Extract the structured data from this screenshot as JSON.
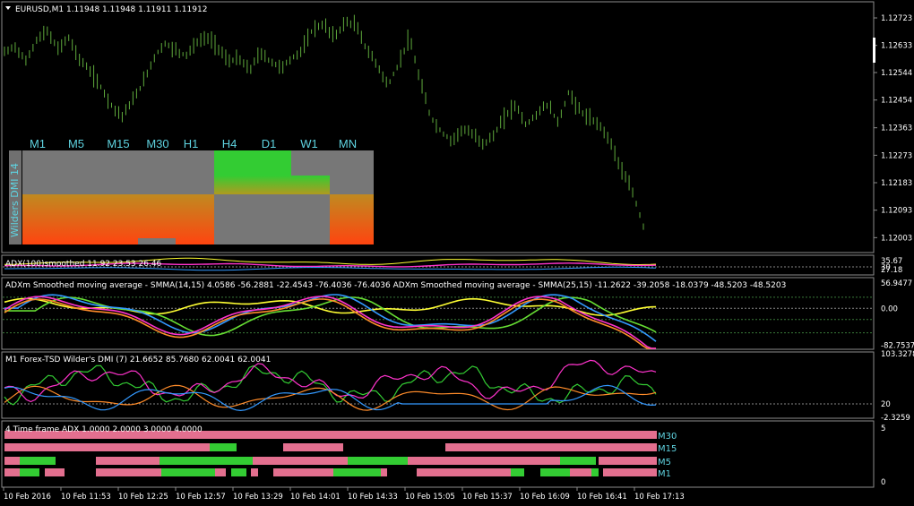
{
  "header": {
    "symbol_label": "EURUSD,M1  1.11948 1.11948 1.11911 1.11912"
  },
  "main_axis": {
    "ticks": [
      "1.12723",
      "1.12633",
      "1.12544",
      "1.12454",
      "1.12363",
      "1.12273",
      "1.12183",
      "1.12093",
      "1.12003"
    ],
    "ylim": [
      1.1196,
      1.1277
    ]
  },
  "dmi_panel": {
    "side_label": "Wilders DMI 14",
    "timeframes": [
      "M1",
      "M5",
      "M15",
      "M30",
      "H1",
      "H4",
      "D1",
      "W1",
      "MN"
    ]
  },
  "pane_adx100": {
    "label": "ADX(100)smoothed 11.92 23.53 26.46",
    "ticks": [
      "35.67",
      "30",
      "27.18"
    ]
  },
  "pane_adxm": {
    "label": "ADXm Smoothed moving average - SMMA(14,15) 4.0586 -56.2881 -22.4543 -76.4036 -76.4036   ADXm Smoothed moving average - SMMA(25,15) -11.2622 -39.2058 -18.0379 -48.5203 -48.5203",
    "ticks": [
      "56.9477",
      "0.00",
      "-82.7537"
    ],
    "ylim": [
      -90,
      65
    ]
  },
  "pane_dmi": {
    "label": "M1 Forex-TSD Wilder's DMI (7) 21.6652 85.7680 62.0041 62.0041",
    "ticks": [
      "103.3278",
      "20",
      "-2.3259"
    ],
    "ylim": [
      -2.3259,
      103.3278
    ]
  },
  "pane_tf_adx": {
    "label": "4 Time frame ADX 1.0000 2.0000 3.0000 4.0000",
    "ticks": [
      "5",
      "0"
    ],
    "rows": [
      "M30",
      "M15",
      "M5",
      "M1"
    ]
  },
  "time_axis": {
    "labels": [
      "10 Feb 2016",
      "10 Feb 11:53",
      "10 Feb 12:25",
      "10 Feb 12:57",
      "10 Feb 13:29",
      "10 Feb 14:01",
      "10 Feb 14:33",
      "10 Feb 15:05",
      "10 Feb 15:37",
      "10 Feb 16:09",
      "10 Feb 16:41",
      "10 Feb 17:13"
    ]
  },
  "colors": {
    "bars": "#5faa3c",
    "pink": "#e36f8f",
    "green": "#33cc33",
    "cyan": "#5fd3e0",
    "yellow": "#ffff33",
    "magenta": "#ff33cc",
    "orange": "#ff8c2a",
    "blue": "#3399ff",
    "lime": "#66dd33"
  },
  "chart_data": {
    "type": "line",
    "title": "EURUSD,M1",
    "series": [
      {
        "name": "EURUSD,M1",
        "values": [
          1.1261,
          1.1263,
          1.1258,
          1.1265,
          1.1268,
          1.1262,
          1.1266,
          1.1259,
          1.1255,
          1.125,
          1.1244,
          1.124,
          1.1245,
          1.1251,
          1.1259,
          1.1264,
          1.1262,
          1.126,
          1.1264,
          1.1266,
          1.1263,
          1.1258,
          1.1259,
          1.1255,
          1.1261,
          1.1258,
          1.1256,
          1.1259,
          1.1262,
          1.1269,
          1.127,
          1.1266,
          1.1271,
          1.127,
          1.1262,
          1.1257,
          1.125,
          1.1257,
          1.1266,
          1.1252,
          1.124,
          1.1235,
          1.1232,
          1.1236,
          1.1234,
          1.1231,
          1.1234,
          1.124,
          1.1244,
          1.1237,
          1.1241,
          1.1244,
          1.1238,
          1.1248,
          1.1242,
          1.1239,
          1.1237,
          1.1231,
          1.1222,
          1.1215,
          1.1204
        ]
      }
    ]
  }
}
